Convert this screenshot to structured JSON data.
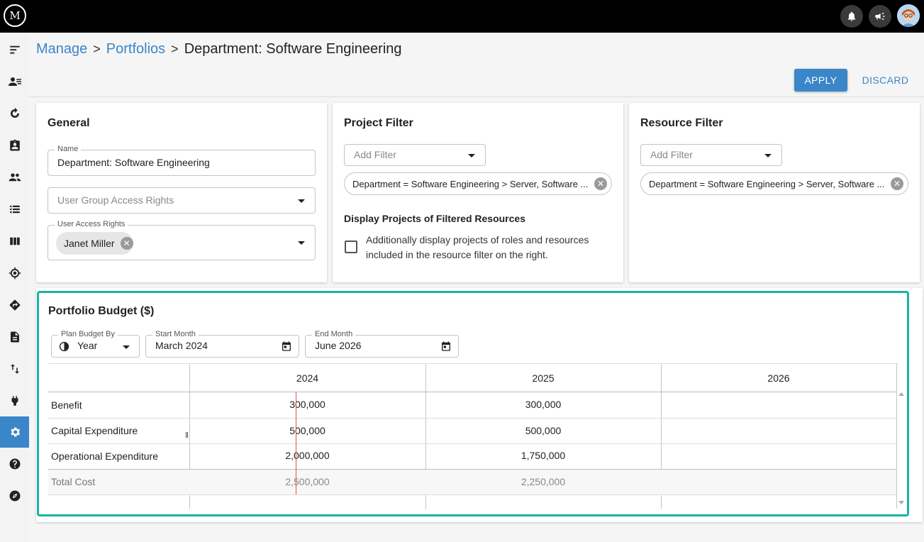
{
  "topbar": {
    "logo_text": "M",
    "notifications_icon": "bell-icon",
    "announcements_icon": "megaphone-icon"
  },
  "sidebar": {
    "items": [
      {
        "icon": "menu-icon"
      },
      {
        "icon": "people-list-icon"
      },
      {
        "icon": "refresh-icon"
      },
      {
        "icon": "clipboard-icon"
      },
      {
        "icon": "group-icon"
      },
      {
        "icon": "list-icon"
      },
      {
        "icon": "columns-icon"
      },
      {
        "icon": "target-icon"
      },
      {
        "icon": "direction-icon"
      },
      {
        "icon": "document-icon"
      },
      {
        "icon": "transfer-icon"
      },
      {
        "icon": "plug-icon"
      },
      {
        "icon": "gear-icon",
        "active": true
      },
      {
        "icon": "help-icon"
      },
      {
        "icon": "compass-icon"
      }
    ]
  },
  "breadcrumb": {
    "items": [
      "Manage",
      "Portfolios",
      "Department: Software Engineering"
    ],
    "separator": ">"
  },
  "actions": {
    "apply": "APPLY",
    "discard": "DISCARD"
  },
  "general": {
    "title": "General",
    "name_label": "Name",
    "name_value": "Department: Software Engineering",
    "group_access_placeholder": "User Group Access Rights",
    "user_access_label": "User Access Rights",
    "user_chip": "Janet Miller"
  },
  "project_filter": {
    "title": "Project Filter",
    "add_filter_placeholder": "Add Filter",
    "chip_text": "Department = Software Engineering > Server, Software ...",
    "display_title": "Display Projects of Filtered Resources",
    "display_desc_line1": "Additionally display projects of roles and resources",
    "display_desc_line2": "included in the resource filter on the right.",
    "checked": false
  },
  "resource_filter": {
    "title": "Resource Filter",
    "add_filter_placeholder": "Add Filter",
    "chip_text": "Department = Software Engineering > Server, Software ..."
  },
  "budget": {
    "title": "Portfolio Budget ($)",
    "plan_by_label": "Plan Budget By",
    "plan_by_value": "Year",
    "start_label": "Start Month",
    "start_value": "March 2024",
    "end_label": "End Month",
    "end_value": "June 2026",
    "columns": [
      "2024",
      "2025",
      "2026"
    ],
    "rows": [
      {
        "label": "Benefit",
        "values": [
          "300,000",
          "300,000",
          ""
        ]
      },
      {
        "label": "Capital Expenditure",
        "values": [
          "500,000",
          "500,000",
          ""
        ]
      },
      {
        "label": "Operational Expenditure",
        "values": [
          "2,000,000",
          "1,750,000",
          ""
        ]
      },
      {
        "label": "Total Cost",
        "values": [
          "2,500,000",
          "2,250,000",
          ""
        ]
      }
    ]
  }
}
